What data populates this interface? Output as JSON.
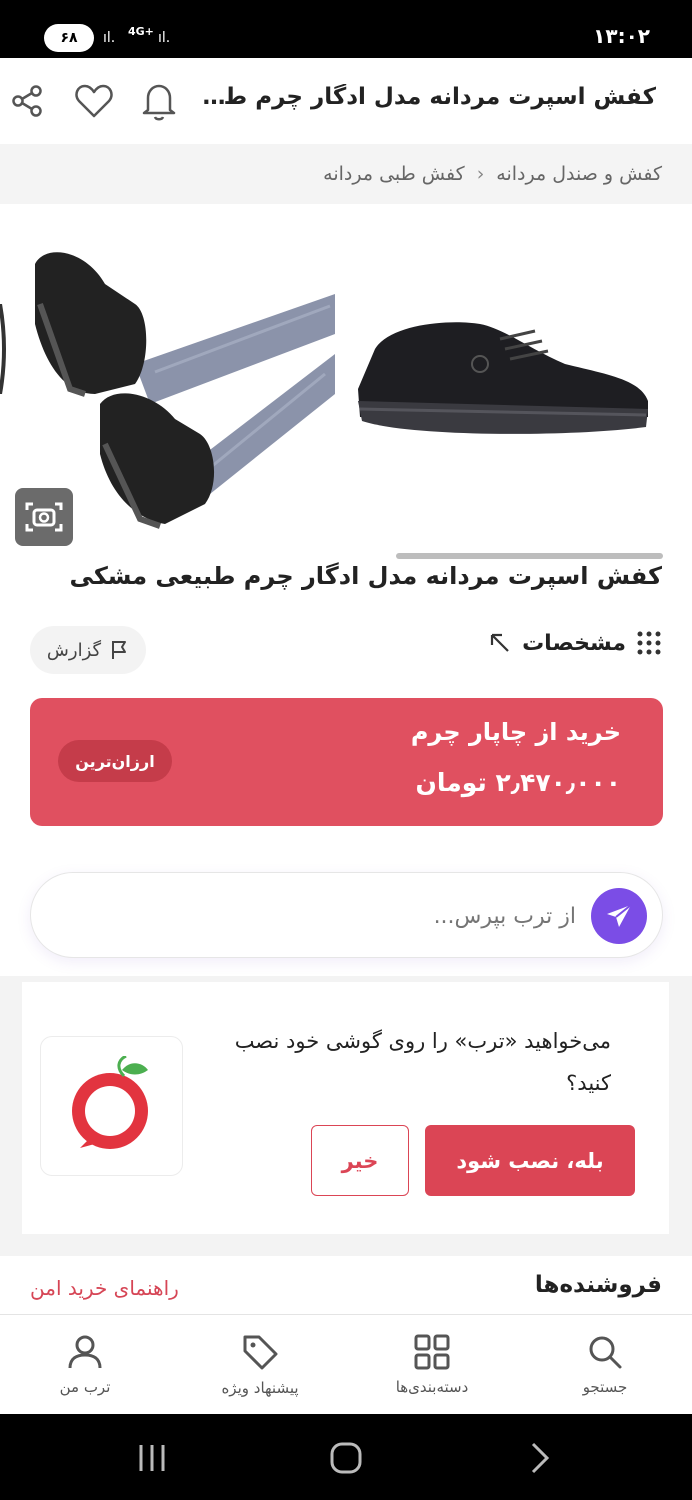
{
  "status_bar": {
    "time": "۱۳:۰۲",
    "battery": "۶۸",
    "network": "4G+"
  },
  "header": {
    "title": "کفش اسپرت مردانه مدل ادگار چرم طبیعی مشکی"
  },
  "breadcrumb": {
    "items": [
      "کفش و صندل مردانه",
      "کفش طبی مردانه"
    ]
  },
  "product": {
    "title": "کفش اسپرت مردانه مدل ادگار چرم طبیعی مشکی"
  },
  "specs": {
    "label": "مشخصات"
  },
  "report": {
    "label": "گزارش"
  },
  "buy": {
    "label": "خرید از چاپار چرم",
    "price": "۲٫۴۷۰٫۰۰۰ تومان",
    "badge": "ارزان‌ترین"
  },
  "ask": {
    "placeholder": "از ترب بپرس..."
  },
  "install": {
    "message": "می‌خواهید «ترب» را روی گوشی خود نصب کنید؟",
    "yes_label": "بله، نصب شود",
    "no_label": "خیر"
  },
  "sellers": {
    "title": "فروشنده‌ها",
    "guide_link": "راهنمای خرید امن"
  },
  "nav": {
    "search": "جستجو",
    "categories": "دسته‌بندی‌ها",
    "offers": "پیشنهاد ویژه",
    "profile": "ترب من"
  },
  "colors": {
    "accent": "#e05060",
    "ask_send": "#7b4de6",
    "badge": "#c53c4a"
  },
  "icons": [
    "share-icon",
    "heart-icon",
    "bell-icon",
    "camera-search-icon",
    "grid-dots-icon",
    "expand-arrow-icon",
    "flag-icon",
    "send-icon",
    "search-icon",
    "categories-icon",
    "tag-icon",
    "user-icon"
  ]
}
